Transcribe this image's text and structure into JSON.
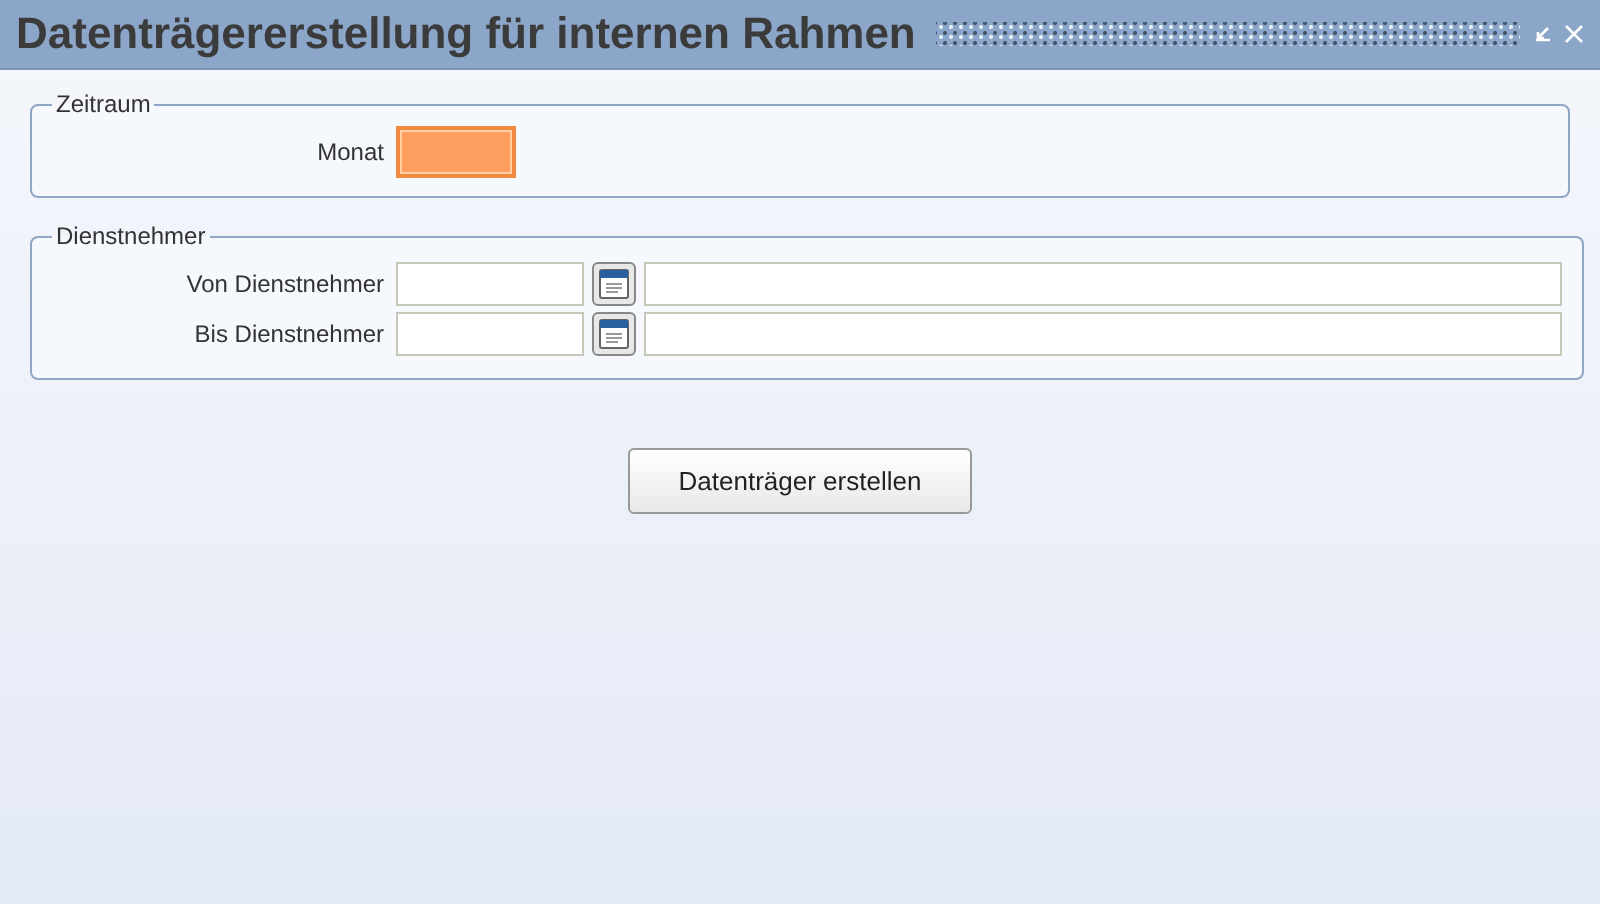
{
  "window": {
    "title": "Datenträgererstellung für internen Rahmen"
  },
  "groups": [
    {
      "title": "Zeitraum",
      "rows": [
        {
          "kind": "month",
          "label": "Monat",
          "value": "",
          "focused": true
        }
      ]
    },
    {
      "title": "Dienstnehmer",
      "rows": [
        {
          "kind": "lookup",
          "label": "Von Dienstnehmer",
          "value": "",
          "focused": false,
          "name_value": ""
        },
        {
          "kind": "lookup",
          "label": "Bis Dienstnehmer",
          "value": "",
          "focused": false,
          "name_value": ""
        }
      ]
    }
  ],
  "buttons": [
    "Datenträger erstellen"
  ]
}
